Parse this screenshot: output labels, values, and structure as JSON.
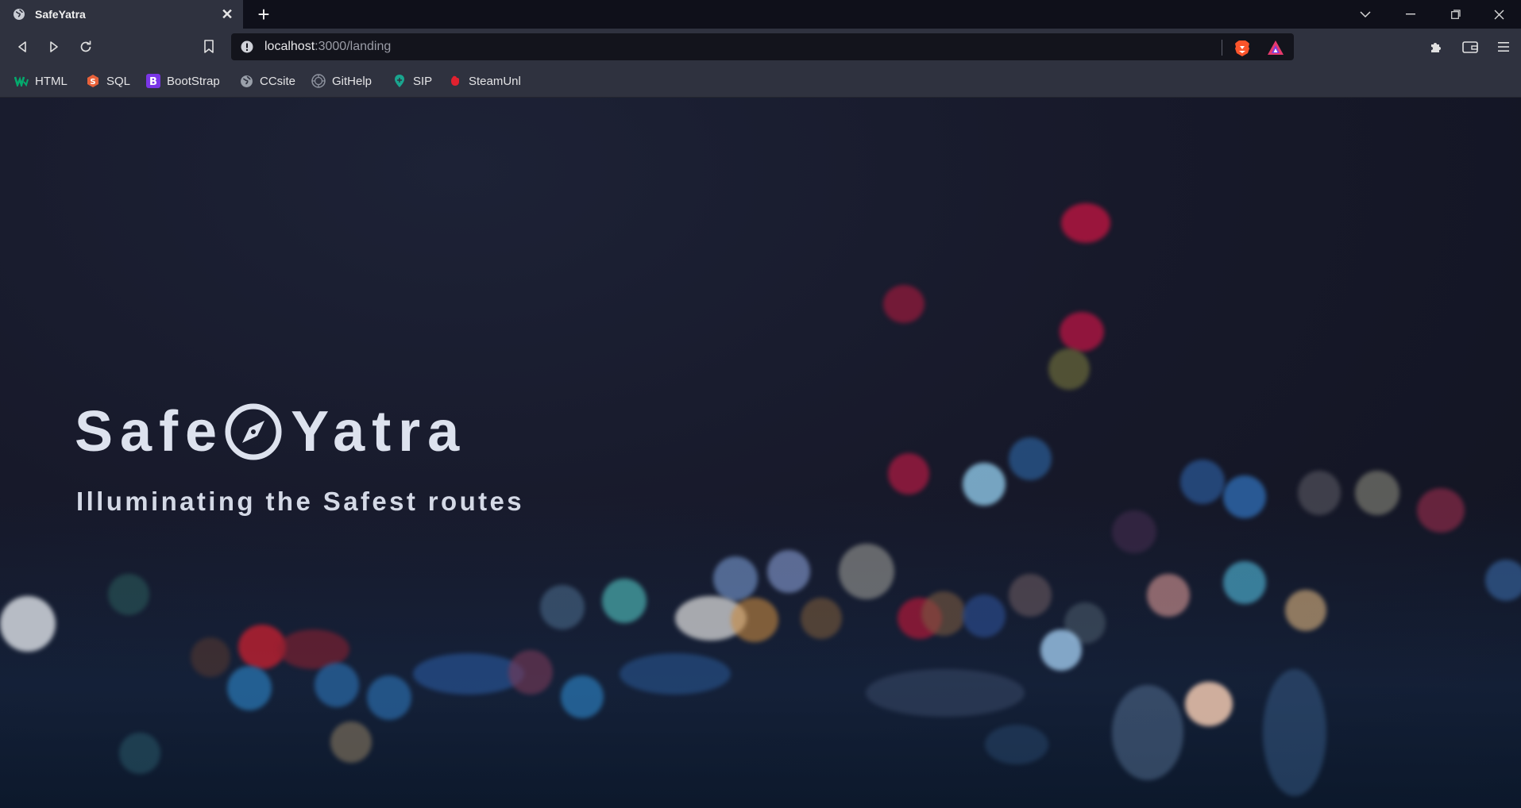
{
  "browser": {
    "tab": {
      "title": "SafeYatra",
      "close_glyph": "✕"
    },
    "new_tab_glyph": "+",
    "address_bar": {
      "host": "localhost",
      "path": ":3000/landing"
    },
    "window_controls": [
      "chevron-down-icon",
      "minimize-icon",
      "restore-icon",
      "close-icon"
    ],
    "toolbar_icons": [
      "back-icon",
      "forward-icon",
      "reload-icon",
      "bookmark-icon",
      "extensions-icon",
      "wallet-icon",
      "menu-icon"
    ]
  },
  "bookmarks": [
    {
      "label": "HTML",
      "icon": "w3schools-icon",
      "color": "#04aa6d"
    },
    {
      "label": "SQL",
      "icon": "sql-icon",
      "color": "#e8623a"
    },
    {
      "label": "BootStrap",
      "icon": "bootstrap-icon",
      "color": "#7a36e6"
    },
    {
      "label": "CCsite",
      "icon": "globe-icon",
      "color": "#9aa0aa"
    },
    {
      "label": "GitHelp",
      "icon": "github-icon",
      "color": "#8f94a0"
    },
    {
      "label": "SIP",
      "icon": "sip-icon",
      "color": "#1aa58f"
    },
    {
      "label": "SteamUnl",
      "icon": "steam-icon",
      "color": "#e0212f"
    }
  ],
  "hero": {
    "brand_left": "Safe",
    "brand_right": "Yatra",
    "logo_icon": "compass-icon",
    "tagline": "Illuminating the Safest routes"
  },
  "colors": {
    "browser_bg": "#0f101a",
    "toolbar_bg": "#2f323f",
    "page_bg": "#17192a",
    "brand_text": "#dde2ee"
  }
}
